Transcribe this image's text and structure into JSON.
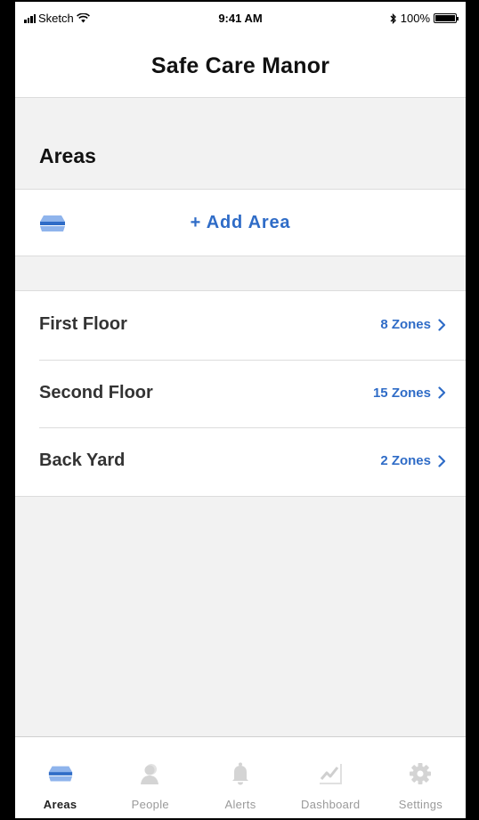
{
  "status_bar": {
    "carrier": "Sketch",
    "time": "9:41 AM",
    "battery": "100%"
  },
  "header": {
    "title": "Safe Care Manor"
  },
  "section": {
    "title": "Areas"
  },
  "add_area": {
    "label": "+ Add Area",
    "icon": "layers-icon"
  },
  "areas": [
    {
      "name": "First Floor",
      "zones": "8 Zones"
    },
    {
      "name": "Second Floor",
      "zones": "15 Zones"
    },
    {
      "name": "Back Yard",
      "zones": "2 Zones"
    }
  ],
  "tab_bar": {
    "active": "Areas",
    "tabs": [
      {
        "label": "Areas",
        "icon": "layers-icon"
      },
      {
        "label": "People",
        "icon": "person-icon"
      },
      {
        "label": "Alerts",
        "icon": "bell-icon"
      },
      {
        "label": "Dashboard",
        "icon": "chart-icon"
      },
      {
        "label": "Settings",
        "icon": "gear-icon"
      }
    ]
  },
  "colors": {
    "accent": "#2f6cc7",
    "accent_light": "#8fb4ec",
    "background": "#f2f2f2",
    "inactive_icon": "#d4d4d4"
  }
}
